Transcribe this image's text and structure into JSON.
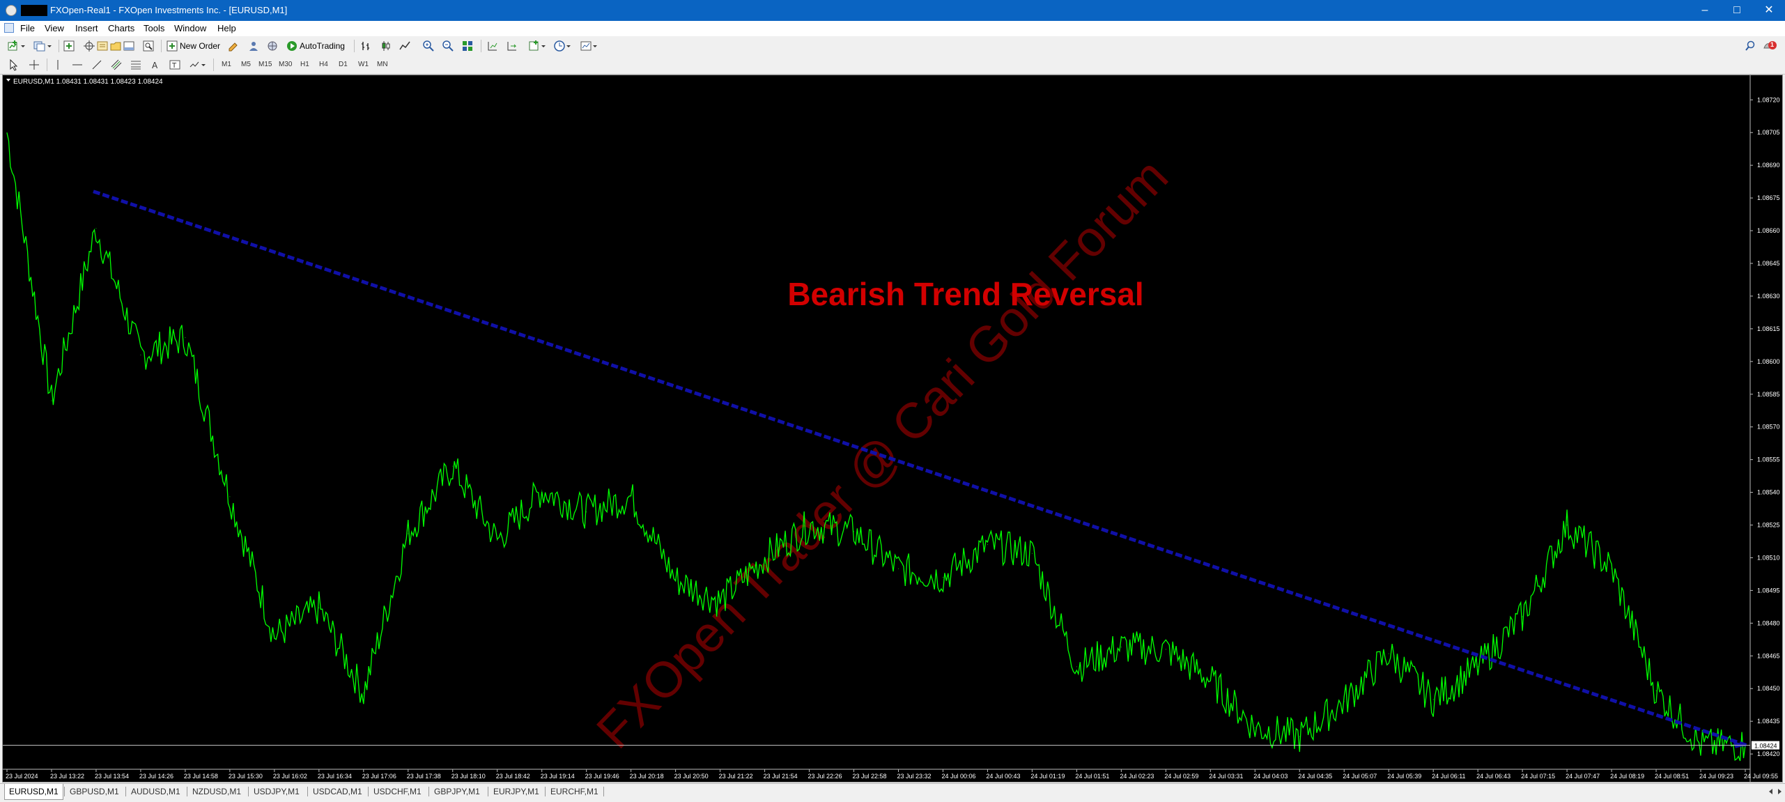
{
  "window": {
    "title": "FXOpen-Real1 - FXOpen Investments Inc. - [EURUSD,M1]"
  },
  "menu": [
    "File",
    "View",
    "Insert",
    "Charts",
    "Tools",
    "Window",
    "Help"
  ],
  "toolbar": {
    "new_order_label": "New Order",
    "autotrading_label": "AutoTrading",
    "alert_count": "1"
  },
  "timeframes": [
    "M1",
    "M5",
    "M15",
    "M30",
    "H1",
    "H4",
    "D1",
    "W1",
    "MN"
  ],
  "chart": {
    "info_text": "EURUSD,M1  1.08431 1.08431 1.08423 1.08424",
    "annotation_text": "Bearish Trend Reversal",
    "watermark_text": "FXOpen Trader @ Cari Gold Forum",
    "current_price_label": "1.08424",
    "price_labels": [
      "1.08720",
      "1.08705",
      "1.08690",
      "1.08675",
      "1.08660",
      "1.08645",
      "1.08630",
      "1.08615",
      "1.08600",
      "1.08585",
      "1.08570",
      "1.08555",
      "1.08540",
      "1.08525",
      "1.08510",
      "1.08495",
      "1.08480",
      "1.08465",
      "1.08450",
      "1.08435",
      "1.08420"
    ],
    "time_labels": [
      "23 Jul 2024",
      "23 Jul 13:22",
      "23 Jul 13:54",
      "23 Jul 14:26",
      "23 Jul 14:58",
      "23 Jul 15:30",
      "23 Jul 16:02",
      "23 Jul 16:34",
      "23 Jul 17:06",
      "23 Jul 17:38",
      "23 Jul 18:10",
      "23 Jul 18:42",
      "23 Jul 19:14",
      "23 Jul 19:46",
      "23 Jul 20:18",
      "23 Jul 20:50",
      "23 Jul 21:22",
      "23 Jul 21:54",
      "23 Jul 22:26",
      "23 Jul 22:58",
      "23 Jul 23:32",
      "24 Jul 00:06",
      "24 Jul 00:43",
      "24 Jul 01:19",
      "24 Jul 01:51",
      "24 Jul 02:23",
      "24 Jul 02:59",
      "24 Jul 03:31",
      "24 Jul 04:03",
      "24 Jul 04:35",
      "24 Jul 05:07",
      "24 Jul 05:39",
      "24 Jul 06:11",
      "24 Jul 06:43",
      "24 Jul 07:15",
      "24 Jul 07:47",
      "24 Jul 08:19",
      "24 Jul 08:51",
      "24 Jul 09:23",
      "24 Jul 09:55"
    ],
    "colors": {
      "background": "#000000",
      "price_line": "#00ff00",
      "trend_line": "#1010a8",
      "annotation": "#d20000",
      "watermark": "#6e0000",
      "axis_text": "#ffffff",
      "current_price_line": "#c8c8c8"
    }
  },
  "chart_data": {
    "type": "line",
    "xlabel": "",
    "ylabel": "",
    "ylim": [
      1.08413,
      1.0873
    ],
    "series": [
      {
        "x": [
          "23 Jul 2024",
          "23 Jul 13:22",
          "23 Jul 13:54",
          "23 Jul 14:26",
          "23 Jul 14:58",
          "23 Jul 15:30",
          "23 Jul 16:02",
          "23 Jul 16:34",
          "23 Jul 17:06",
          "23 Jul 17:38",
          "23 Jul 18:10",
          "23 Jul 18:42",
          "23 Jul 19:14",
          "23 Jul 19:46",
          "23 Jul 20:18",
          "23 Jul 20:50",
          "23 Jul 21:22",
          "23 Jul 21:54",
          "23 Jul 22:26",
          "23 Jul 22:58",
          "23 Jul 23:32",
          "24 Jul 00:06",
          "24 Jul 00:43",
          "24 Jul 01:19",
          "24 Jul 01:51",
          "24 Jul 02:23",
          "24 Jul 02:59",
          "24 Jul 03:31",
          "24 Jul 04:03",
          "24 Jul 04:35",
          "24 Jul 05:07",
          "24 Jul 05:39",
          "24 Jul 06:11",
          "24 Jul 06:43",
          "24 Jul 07:15",
          "24 Jul 07:47",
          "24 Jul 08:19",
          "24 Jul 08:51",
          "24 Jul 09:23",
          "24 Jul 09:55"
        ],
        "values": [
          1.08705,
          1.08582,
          1.08661,
          1.08603,
          1.08611,
          1.08538,
          1.08474,
          1.08487,
          1.08448,
          1.08521,
          1.08552,
          1.08518,
          1.08541,
          1.08531,
          1.08538,
          1.085,
          1.0849,
          1.0851,
          1.08525,
          1.08522,
          1.08505,
          1.08501,
          1.08516,
          1.08512,
          1.0846,
          1.08469,
          1.08468,
          1.08454,
          1.08432,
          1.08428,
          1.08444,
          1.08466,
          1.08445,
          1.0846,
          1.08483,
          1.08525,
          1.08505,
          1.08449,
          1.08424,
          1.08424
        ]
      },
      {
        "name": "Bearish Trend Reversal",
        "x": [
          "23 Jul 13:54",
          "24 Jul 09:55"
        ],
        "values": [
          1.08678,
          1.08424
        ]
      }
    ]
  }
}
